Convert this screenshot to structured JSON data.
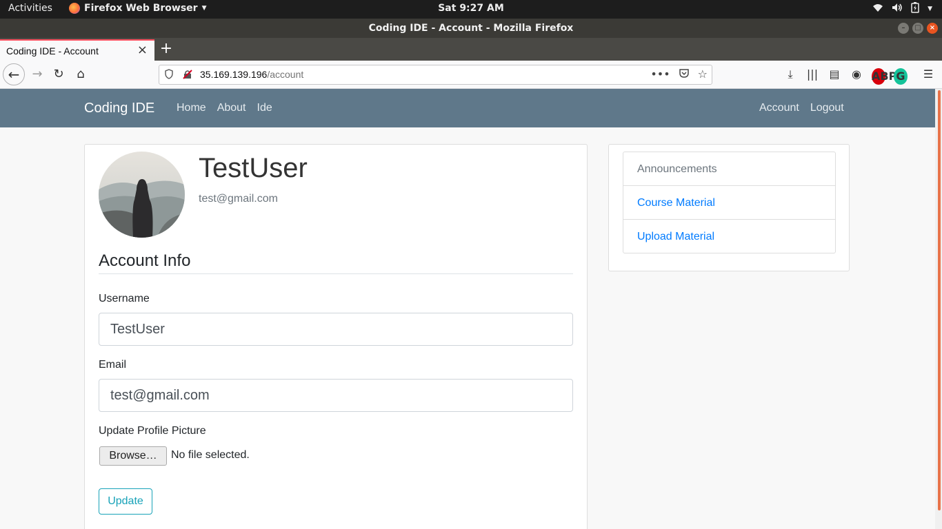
{
  "system": {
    "activities": "Activities",
    "app_menu": "Firefox Web Browser",
    "clock": "Sat  9:27 AM"
  },
  "window": {
    "title": "Coding IDE - Account - Mozilla Firefox"
  },
  "tab": {
    "title": "Coding IDE - Account"
  },
  "urlbar": {
    "host": "35.169.139.196",
    "path": "/account"
  },
  "site_nav": {
    "brand": "Coding IDE",
    "left_links": [
      "Home",
      "About",
      "Ide"
    ],
    "right_links": [
      "Account",
      "Logout"
    ]
  },
  "profile": {
    "username": "TestUser",
    "email": "test@gmail.com"
  },
  "form": {
    "section_title": "Account Info",
    "username_label": "Username",
    "username_value": "TestUser",
    "email_label": "Email",
    "email_value": "test@gmail.com",
    "picture_label": "Update Profile Picture",
    "browse_label": "Browse…",
    "file_status": "No file selected.",
    "submit_label": "Update"
  },
  "sidebar": {
    "title": "Announcements",
    "links": [
      "Course Material",
      "Upload Material"
    ]
  },
  "colors": {
    "site_nav_bg": "#5f788a",
    "link": "#007bff",
    "info_button": "#17a2b8",
    "tab_accent": "#ff4f5e"
  }
}
